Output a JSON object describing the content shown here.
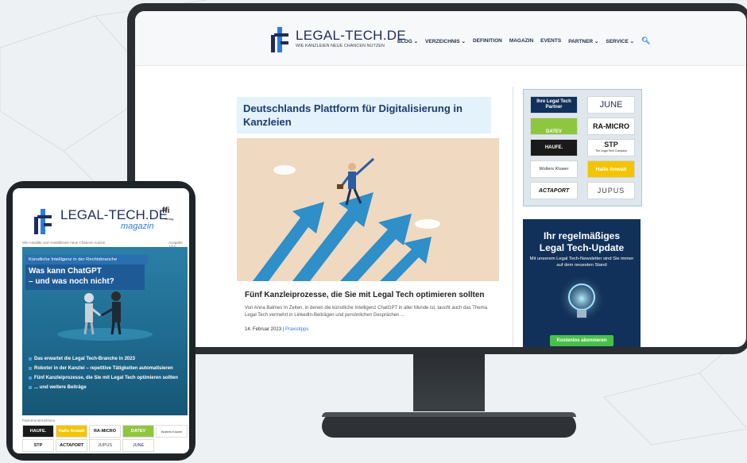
{
  "site": {
    "logo_main": "LEGAL-TECH.DE",
    "logo_tagline": "WIE KANZLEIEN NEUE CHANCEN NUTZEN",
    "nav": [
      "BLOG ⌄",
      "VERZEICHNIS ⌄",
      "DEFINITION",
      "MAGAZIN",
      "EVENTS",
      "PARTNER ⌄",
      "SERVICE ⌄"
    ],
    "hero_title": "Deutschlands Plattform für Digitalisierung in Kanzleien",
    "article": {
      "title": "Fünf Kanzleiprozesse, die Sie mit Legal Tech optimieren sollten",
      "excerpt": "Von Anna Balmes In Zeiten, in denen die künstliche Intelligenz ChatGPT in aller Munde ist, taucht auch das Thema Legal Tech vermehrt in LinkedIn-Beiträgen und persönlichen Gesprächen ...",
      "date": "14. Februar 2023",
      "sep": " | ",
      "category": "Praxistipps"
    },
    "partners": {
      "header_line1": "Ihre Legal Tech",
      "header_line2": "Partner",
      "logos": [
        "JUNE",
        "DATEV",
        "RA-MICRO",
        "HAUFE.",
        "STP",
        "Wolters Kluwer",
        "Hallo Anwalt",
        "ACTAPORT",
        "JUPUS"
      ],
      "stp_sub": "The Legal Tech Company"
    },
    "newsletter": {
      "title_line1": "Ihr regelmäßiges",
      "title_line2": "Legal Tech-Update",
      "text": "Mit unserem Legal Tech-Newsletter sind Sie immer auf dem neuesten Stand",
      "button": "Kostenlos abonnieren"
    }
  },
  "magazine": {
    "logo_main": "LEGAL-TECH.DE",
    "logo_sub": "magazin",
    "publisher": "ffi",
    "publisher_sub": "Verlag",
    "tagline": "Wie Anwälte und Anwältinnen neue Chancen nutzen",
    "issue": "Ausgabe 1/23",
    "cover_kicker": "Künstliche Intelligenz in der Rechtsbranche",
    "cover_title_line1": "Was kann ChatGPT",
    "cover_title_line2": "– und was noch nicht?",
    "items": [
      "Das erwartet die Legal Tech-Branche in 2023",
      "Roboter in der Kanzlei – repetitive Tätigkeiten automatisieren",
      "Fünf Kanzleiprozesse, die Sie mit Legal Tech optimieren sollten",
      "... und weitere Beiträge"
    ],
    "partners_label": "Partnerunternehmen",
    "partner_logos": [
      "HAUFE.",
      "Hallo Anwalt",
      "RA-MICRO",
      "DATEV",
      "Wolters Kluwer",
      "STP",
      "ACTAPORT",
      "JUPUS",
      "JUNE"
    ]
  },
  "colors": {
    "navy": "#1e2c5a",
    "accent_blue": "#2a7de1",
    "green": "#48c14a",
    "cover_blue": "#1f6a8f"
  }
}
